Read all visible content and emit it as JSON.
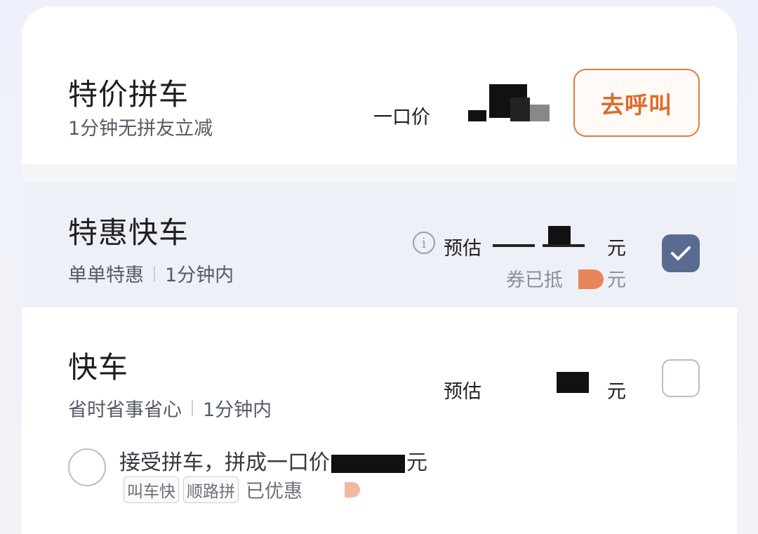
{
  "pinche": {
    "title": "特价拼车",
    "subtitle": "1分钟无拼友立减",
    "price_label": "一口价",
    "call_button": "去呼叫"
  },
  "tehui": {
    "title": "特惠快车",
    "tag1": "单单特惠",
    "tag2": "1分钟内",
    "est_label": "预估",
    "yuan": "元",
    "coupon_label": "券已抵",
    "coupon_yuan": "元",
    "selected": true
  },
  "kuaiche": {
    "title": "快车",
    "tag1": "省时省事省心",
    "tag2": "1分钟内",
    "est_label": "预估",
    "yuan": "元",
    "selected": false,
    "pool_option": {
      "text": "接受拼车，拼成一口价",
      "yuan": "元",
      "tag1": "叫车快",
      "tag2": "顺路拼",
      "discount_label": "已优惠"
    }
  },
  "colors": {
    "accent_orange": "#e06a2a",
    "selected_bg": "#edf0f7",
    "checkbox_on": "#5a6b91"
  }
}
